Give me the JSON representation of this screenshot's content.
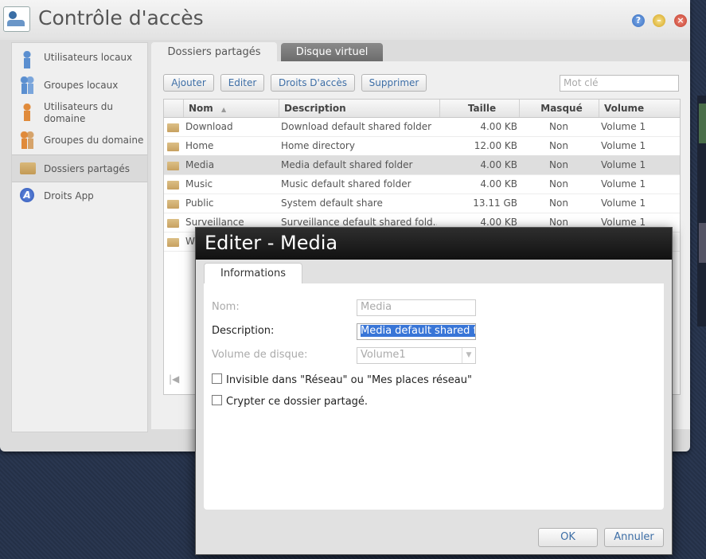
{
  "window": {
    "title": "Contrôle d'accès",
    "controls": {
      "help": "?",
      "minimize": "–",
      "close": "×"
    }
  },
  "sidebar": {
    "items": [
      {
        "label": "Utilisateurs locaux",
        "icon": "user-icon"
      },
      {
        "label": "Groupes locaux",
        "icon": "group-icon"
      },
      {
        "label": "Utilisateurs du domaine",
        "icon": "domain-user-icon"
      },
      {
        "label": "Groupes du domaine",
        "icon": "domain-group-icon"
      },
      {
        "label": "Dossiers partagés",
        "icon": "folder-icon",
        "selected": true
      },
      {
        "label": "Droits App",
        "icon": "app-rights-icon",
        "glyph": "A"
      }
    ]
  },
  "tabs": [
    {
      "label": "Dossiers partagés",
      "active": true
    },
    {
      "label": "Disque virtuel",
      "active": false
    }
  ],
  "toolbar": {
    "add": "Ajouter",
    "edit": "Editer",
    "access_rights": "Droits D'accès",
    "delete": "Supprimer",
    "search_placeholder": "Mot clé"
  },
  "table": {
    "columns": [
      "Nom",
      "Description",
      "Taille",
      "Masqué",
      "Volume"
    ],
    "sort_indicator": "▲",
    "rows": [
      {
        "name": "Download",
        "description": "Download default shared folder",
        "size": "4.00 KB",
        "hidden": "Non",
        "volume": "Volume 1"
      },
      {
        "name": "Home",
        "description": "Home directory",
        "size": "12.00 KB",
        "hidden": "Non",
        "volume": "Volume 1"
      },
      {
        "name": "Media",
        "description": "Media default shared folder",
        "size": "4.00 KB",
        "hidden": "Non",
        "volume": "Volume 1",
        "selected": true
      },
      {
        "name": "Music",
        "description": "Music default shared folder",
        "size": "4.00 KB",
        "hidden": "Non",
        "volume": "Volume 1"
      },
      {
        "name": "Public",
        "description": "System default share",
        "size": "13.11 GB",
        "hidden": "Non",
        "volume": "Volume 1"
      },
      {
        "name": "Surveillance",
        "description": "Surveillance default shared fold...",
        "size": "4.00 KB",
        "hidden": "Non",
        "volume": "Volume 1"
      },
      {
        "name": "W",
        "description": "",
        "size": "",
        "hidden": "",
        "volume": ""
      }
    ],
    "pager_first": "|◀"
  },
  "dialog": {
    "title": "Editer - Media",
    "tab": "Informations",
    "fields": {
      "name_label": "Nom:",
      "name_value": "Media",
      "description_label": "Description:",
      "description_value": "Media default shared f",
      "volume_label": "Volume de disque:",
      "volume_value": "Volume1"
    },
    "checkboxes": {
      "invisible": "Invisible dans \"Réseau\" ou \"Mes places réseau\"",
      "encrypt": "Crypter ce dossier partagé."
    },
    "ok": "OK",
    "cancel": "Annuler"
  },
  "colors": {
    "accent_text": "#3d6ea6",
    "selection": "#3875d7",
    "dialog_title_bg": "#1a1a1a"
  }
}
